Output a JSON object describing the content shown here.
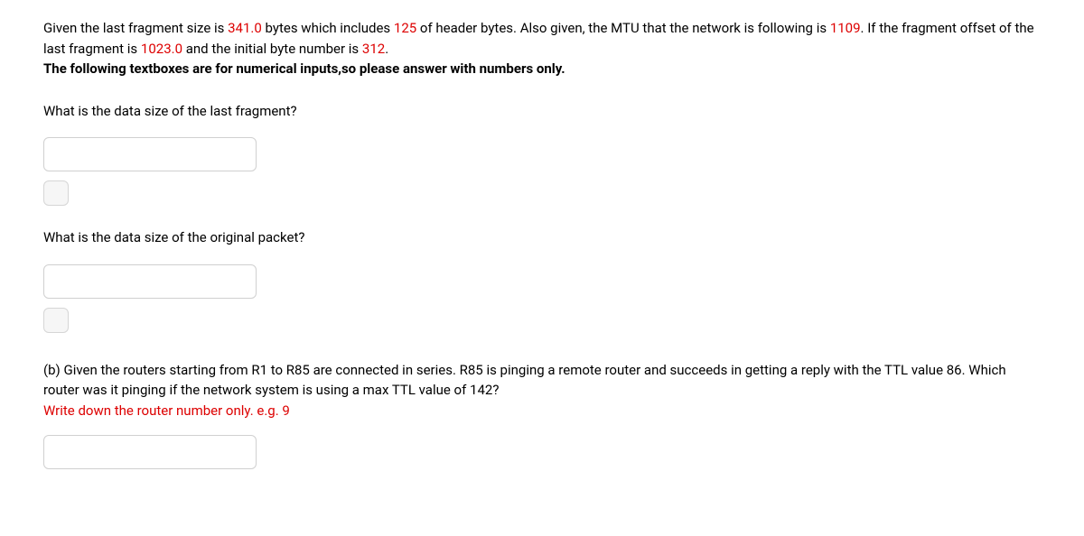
{
  "intro": {
    "t1": "Given the last fragment size is ",
    "v1": "341.0",
    "t2": " bytes which includes ",
    "v2": "125",
    "t3": " of header bytes. Also given, the MTU that the network is following is ",
    "v3": "1109",
    "t4": ". If the fragment offset of the last fragment is ",
    "v4": "1023.0",
    "t5": " and the initial byte number is ",
    "v5": "312",
    "t6": "."
  },
  "instruction": "The following textboxes are for numerical inputs,so please answer with numbers only.",
  "q1": {
    "label": "What is the data size of the last fragment?"
  },
  "q2": {
    "label": "What is the data size of the original packet?"
  },
  "partB": {
    "text": "(b) Given the routers starting from R1 to R85 are connected in series. R85 is pinging a remote router and succeeds in getting a reply with the TTL value 86. Which router was it pinging if the network system is using a max TTL value of 142?",
    "hint": "Write down the router number only. e.g. 9"
  }
}
